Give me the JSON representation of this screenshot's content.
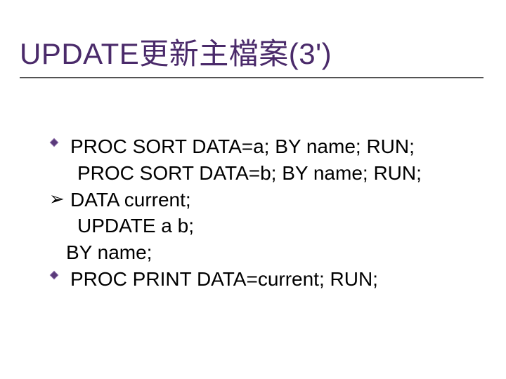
{
  "title": "UPDATE更新主檔案(3')",
  "lines": {
    "l1": "PROC SORT DATA=a; BY name; RUN;",
    "l2": "PROC SORT DATA=b; BY name; RUN;",
    "l3": "DATA current;",
    "l4": "UPDATE a b;",
    "l5": "BY name;",
    "l6": "PROC PRINT DATA=current; RUN;"
  }
}
